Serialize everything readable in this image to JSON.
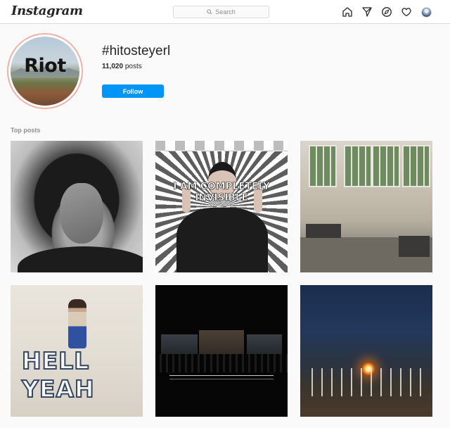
{
  "header": {
    "logo": "Instagram",
    "search_placeholder": "Search",
    "nav_icons": [
      "home-icon",
      "direct-icon",
      "explore-icon",
      "activity-icon",
      "profile-avatar"
    ]
  },
  "profile": {
    "image_text": "Riot",
    "tag": "#hitosteyerl",
    "posts_count": "11,020",
    "posts_label": "posts",
    "follow_label": "Follow"
  },
  "top_posts": {
    "title": "Top posts",
    "items": [
      {
        "caption": ""
      },
      {
        "caption": "I AM COMPLETELY INVISIBLE"
      },
      {
        "caption": ""
      },
      {
        "caption": "HELL YEAH"
      },
      {
        "caption": ""
      },
      {
        "caption": ""
      }
    ]
  },
  "colors": {
    "accent": "#0095f6",
    "border": "#dbdbdb",
    "background": "#fafafa"
  }
}
